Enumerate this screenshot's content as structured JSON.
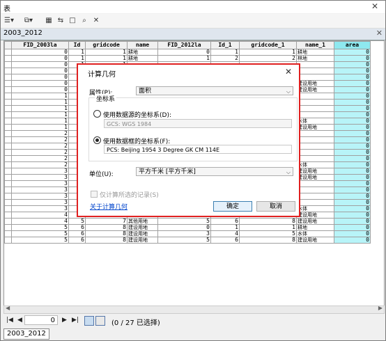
{
  "window": {
    "title": "表"
  },
  "table_tab": {
    "label": "2003_2012"
  },
  "columns": [
    "FID_2003la",
    "Id",
    "gridcode",
    "name",
    "FID_2012la",
    "Id_1",
    "gridcode_1",
    "name_1",
    "area"
  ],
  "rows": [
    [
      "0",
      "1",
      "1",
      "耕地",
      "0",
      "1",
      "1",
      "耕地",
      "0"
    ],
    [
      "0",
      "1",
      "1",
      "耕地",
      "1",
      "2",
      "2",
      "林地",
      "0"
    ],
    [
      "0",
      "1",
      "1",
      "",
      "",
      "",
      "",
      "",
      "0"
    ],
    [
      "0",
      "1",
      "1",
      "",
      "",
      "",
      "",
      "",
      "0"
    ],
    [
      "0",
      "1",
      "1",
      "",
      "",
      "",
      "",
      "",
      "0"
    ],
    [
      "0",
      "1",
      "1",
      "",
      "",
      "",
      "",
      "建设用地",
      "0"
    ],
    [
      "0",
      "1",
      "1",
      "",
      "",
      "",
      "",
      "建设用地",
      "0"
    ],
    [
      "1",
      "2",
      "2",
      "",
      "",
      "",
      "",
      "",
      "0"
    ],
    [
      "1",
      "2",
      "2",
      "",
      "",
      "",
      "",
      "",
      "0"
    ],
    [
      "1",
      "2",
      "2",
      "",
      "",
      "",
      "",
      "",
      "0"
    ],
    [
      "1",
      "2",
      "2",
      "",
      "",
      "",
      "",
      "",
      "0"
    ],
    [
      "1",
      "2",
      "2",
      "",
      "",
      "",
      "",
      "水体",
      "0"
    ],
    [
      "1",
      "2",
      "2",
      "",
      "",
      "",
      "",
      "建设用地",
      "0"
    ],
    [
      "2",
      "3",
      "3",
      "",
      "",
      "",
      "",
      "",
      "0"
    ],
    [
      "2",
      "3",
      "3",
      "",
      "",
      "",
      "",
      "",
      "0"
    ],
    [
      "2",
      "3",
      "3",
      "",
      "",
      "",
      "",
      "",
      "0"
    ],
    [
      "2",
      "3",
      "3",
      "",
      "",
      "",
      "",
      "",
      "0"
    ],
    [
      "2",
      "3",
      "3",
      "",
      "",
      "",
      "",
      "",
      "0"
    ],
    [
      "2",
      "3",
      "3",
      "",
      "",
      "",
      "",
      "水体",
      "0"
    ],
    [
      "3",
      "4",
      "4",
      "",
      "",
      "",
      "",
      "建设用地",
      "0"
    ],
    [
      "3",
      "4",
      "4",
      "",
      "",
      "",
      "",
      "建设用地",
      "0"
    ],
    [
      "3",
      "4",
      "4",
      "",
      "",
      "",
      "",
      "",
      "0"
    ],
    [
      "3",
      "4",
      "4",
      "",
      "",
      "",
      "",
      "",
      "0"
    ],
    [
      "3",
      "4",
      "4",
      "",
      "",
      "",
      "",
      "",
      "0"
    ],
    [
      "3",
      "4",
      "4",
      "",
      "",
      "",
      "",
      "",
      "0"
    ],
    [
      "3",
      "4",
      "4",
      "",
      "",
      "",
      "",
      "水体",
      "0"
    ],
    [
      "4",
      "5",
      "5",
      "水体",
      "5",
      "6",
      "8",
      "建设用地",
      "0"
    ],
    [
      "4",
      "5",
      "7",
      "其他用地",
      "5",
      "6",
      "8",
      "建设用地",
      "0"
    ],
    [
      "5",
      "6",
      "8",
      "建设用地",
      "0",
      "1",
      "1",
      "耕地",
      "0"
    ],
    [
      "5",
      "6",
      "8",
      "建设用地",
      "3",
      "4",
      "5",
      "水体",
      "0"
    ],
    [
      "5",
      "6",
      "8",
      "建设用地",
      "5",
      "6",
      "8",
      "建设用地",
      "0"
    ]
  ],
  "nav": {
    "record": "0",
    "status": "(0 / 27 已选择)"
  },
  "bottom_tab": "2003_2012",
  "dialog": {
    "title": "计算几何",
    "property_label": "属性(P):",
    "property_value": "面积",
    "coord_group": "坐标系",
    "use_source_label": "使用数据源的坐标系(D):",
    "source_cs": "GCS: WGS 1984",
    "use_frame_label": "使用数据框的坐标系(F):",
    "frame_cs": "PCS: Beijing 1954 3 Degree GK CM 114E",
    "units_label": "单位(U):",
    "units_value": "平方千米 [平方千米]",
    "selected_only": "仅计算所选的记录(S)",
    "about_link": "关于计算几何",
    "ok": "确定",
    "cancel": "取消"
  }
}
